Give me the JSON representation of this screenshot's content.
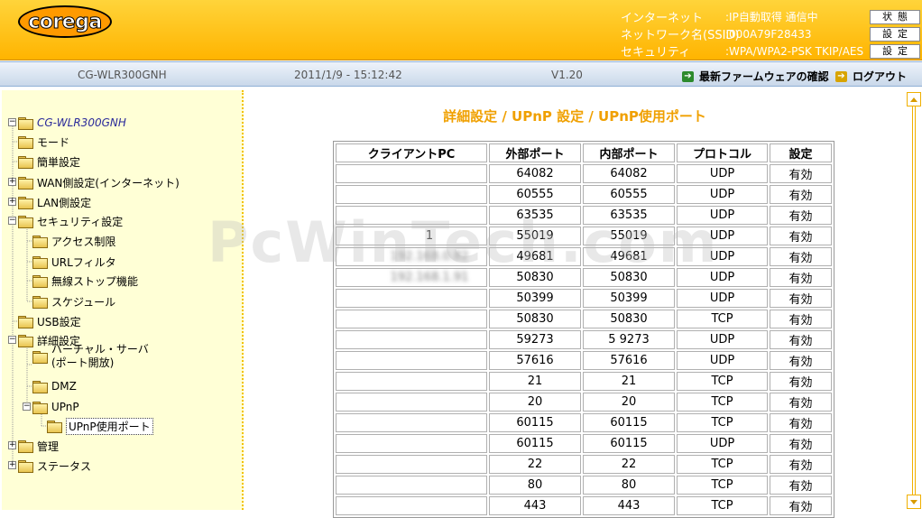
{
  "header": {
    "logo": "corega",
    "info": [
      {
        "label": "インターネット",
        "value": ":IP自動取得 通信中",
        "button": "状態"
      },
      {
        "label": "ネットワーク名(SSID)",
        "value": ":000A79F28433",
        "button": "設定"
      },
      {
        "label": "セキュリティ",
        "value": ":WPA/WPA2-PSK  TKIP/AES",
        "button": "設定"
      }
    ]
  },
  "statusbar": {
    "model": "CG-WLR300GNH",
    "datetime": "2011/1/9 - 15:12:42",
    "version": "V1.20",
    "firmware_link": "最新ファームウェアの確認",
    "logout_link": "ログアウト"
  },
  "sidebar": {
    "root": "CG-WLR300GNH",
    "items": [
      {
        "label": "モード"
      },
      {
        "label": "簡単設定"
      },
      {
        "label": "WAN側設定(インターネット)"
      },
      {
        "label": "LAN側設定"
      },
      {
        "label": "セキュリティ設定"
      },
      {
        "label": "アクセス制限"
      },
      {
        "label": "URLフィルタ"
      },
      {
        "label": "無線ストップ機能"
      },
      {
        "label": "スケジュール"
      },
      {
        "label": "USB設定"
      },
      {
        "label": "詳細設定"
      },
      {
        "label": "バーチャル・サーバ"
      },
      {
        "label": "(ポート開放)"
      },
      {
        "label": "DMZ"
      },
      {
        "label": "UPnP"
      },
      {
        "label": "UPnP使用ポート"
      },
      {
        "label": "管理"
      },
      {
        "label": "ステータス"
      }
    ]
  },
  "main": {
    "title": "詳細設定 / UPnP 設定 / UPnP使用ポート",
    "watermark": "PcWinTech.com",
    "columns": [
      "クライアントPC",
      "外部ポート",
      "内部ポート",
      "プロトコル",
      "設定"
    ],
    "rows": [
      {
        "client": "",
        "ext": "64082",
        "int": "64082",
        "proto": "UDP",
        "enabled": "有効"
      },
      {
        "client": "",
        "ext": "60555",
        "int": "60555",
        "proto": "UDP",
        "enabled": "有効"
      },
      {
        "client": "",
        "ext": "63535",
        "int": "63535",
        "proto": "UDP",
        "enabled": "有効"
      },
      {
        "client": "1",
        "ext": "55019",
        "int": "55019",
        "proto": "UDP",
        "enabled": "有効"
      },
      {
        "client": "192.168.0.82",
        "ext": "49681",
        "int": "49681",
        "proto": "UDP",
        "enabled": "有効"
      },
      {
        "client": "192.168.1.91",
        "ext": "50830",
        "int": "50830",
        "proto": "UDP",
        "enabled": "有効"
      },
      {
        "client": "",
        "ext": "50399",
        "int": "50399",
        "proto": "UDP",
        "enabled": "有効"
      },
      {
        "client": "",
        "ext": "50830",
        "int": "50830",
        "proto": "TCP",
        "enabled": "有効"
      },
      {
        "client": "",
        "ext": "59273",
        "int": "5 9273",
        "proto": "UDP",
        "enabled": "有効"
      },
      {
        "client": "",
        "ext": "57616",
        "int": "57616",
        "proto": "UDP",
        "enabled": "有効"
      },
      {
        "client": "",
        "ext": "21",
        "int": "21",
        "proto": "TCP",
        "enabled": "有効"
      },
      {
        "client": "",
        "ext": "20",
        "int": "20",
        "proto": "TCP",
        "enabled": "有効"
      },
      {
        "client": "",
        "ext": "60115",
        "int": "60115",
        "proto": "TCP",
        "enabled": "有効"
      },
      {
        "client": "",
        "ext": "60115",
        "int": "60115",
        "proto": "UDP",
        "enabled": "有効"
      },
      {
        "client": "",
        "ext": "22",
        "int": "22",
        "proto": "TCP",
        "enabled": "有効"
      },
      {
        "client": "",
        "ext": "80",
        "int": "80",
        "proto": "TCP",
        "enabled": "有効"
      },
      {
        "client": "",
        "ext": "443",
        "int": "443",
        "proto": "TCP",
        "enabled": "有効"
      }
    ]
  },
  "colors": {
    "header_top": "#ffd43a",
    "header_bottom": "#ffb400",
    "title_orange": "#f0a000",
    "sidebar_bg": "#ffffd6"
  }
}
